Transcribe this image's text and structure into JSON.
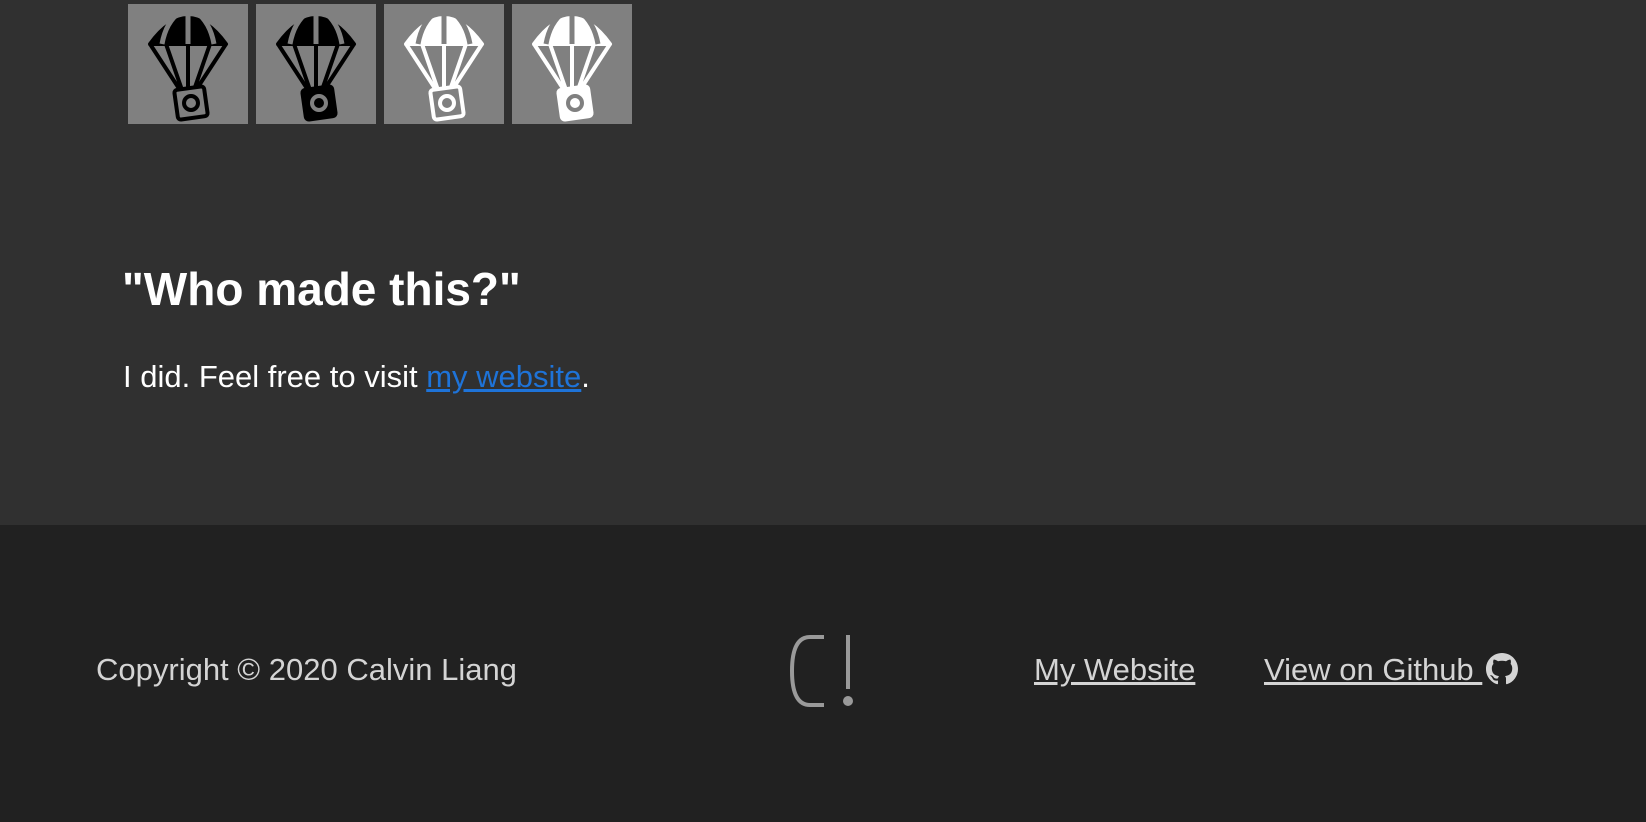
{
  "icons": {
    "tiles": [
      {
        "name": "parachute-icon-outline-black"
      },
      {
        "name": "parachute-icon-solid-black"
      },
      {
        "name": "parachute-icon-outline-white"
      },
      {
        "name": "parachute-icon-solid-white"
      }
    ],
    "tile_bg": "#808080"
  },
  "content": {
    "heading": "\"Who made this?\"",
    "para_prefix": "I did. Feel free to visit ",
    "para_link": "my website",
    "para_suffix": "."
  },
  "footer": {
    "copyright": "Copyright © 2020 Calvin Liang",
    "logo_icon": "cl-logo-icon",
    "links": {
      "website": "My Website",
      "github": "View on Github "
    },
    "github_icon": "github-icon"
  },
  "colors": {
    "main_bg": "#303030",
    "footer_bg": "#212121",
    "link": "#1e73d8",
    "footer_text": "#d4d4d4"
  }
}
